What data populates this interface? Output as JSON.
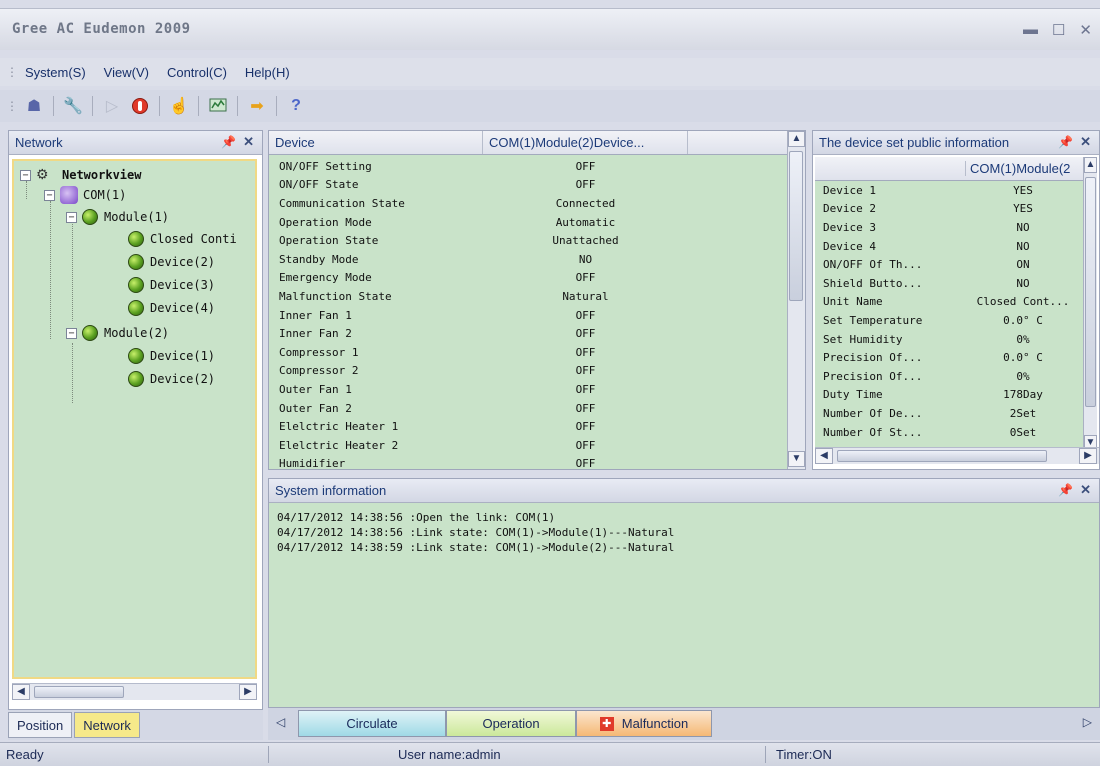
{
  "window": {
    "title": "Gree AC Eudemon 2009"
  },
  "menu": [
    "System(S)",
    "View(V)",
    "Control(C)",
    "Help(H)"
  ],
  "toolbar": [
    "network-icon",
    "wrench-icon",
    "play-icon",
    "stop-icon",
    "hand-icon",
    "monitor-icon",
    "arrow-icon",
    "help-icon"
  ],
  "network_pane": {
    "title": "Network",
    "tree": {
      "root": "Networkview",
      "com": "COM(1)",
      "module1": "Module(1)",
      "module1_children": [
        "Closed Conti",
        "Device(2)",
        "Device(3)",
        "Device(4)"
      ],
      "module2": "Module(2)",
      "module2_children": [
        "Device(1)",
        "Device(2)"
      ]
    }
  },
  "left_tabs": [
    "Position",
    "Network"
  ],
  "device_table": {
    "columns": [
      "Device",
      "COM(1)Module(2)Device..."
    ],
    "rows": [
      [
        "ON/OFF Setting",
        "OFF"
      ],
      [
        "ON/OFF State",
        "OFF"
      ],
      [
        "Communication State",
        "Connected"
      ],
      [
        "Operation Mode",
        "Automatic"
      ],
      [
        "Operation State",
        "Unattached"
      ],
      [
        "Standby Mode",
        "NO"
      ],
      [
        "Emergency Mode",
        "OFF"
      ],
      [
        "Malfunction State",
        "Natural"
      ],
      [
        "Inner Fan 1",
        "OFF"
      ],
      [
        "Inner Fan 2",
        "OFF"
      ],
      [
        "Compressor 1",
        "OFF"
      ],
      [
        "Compressor 2",
        "OFF"
      ],
      [
        "Outer Fan 1",
        "OFF"
      ],
      [
        "Outer Fan 2",
        "OFF"
      ],
      [
        "Elelctric Heater 1",
        "OFF"
      ],
      [
        "Elelctric Heater 2",
        "OFF"
      ],
      [
        "Humidifier",
        "OFF"
      ]
    ]
  },
  "info_pane": {
    "title": "The device set public information",
    "column": "COM(1)Module(2",
    "rows": [
      [
        "Device 1",
        "YES"
      ],
      [
        "Device 2",
        "YES"
      ],
      [
        "Device 3",
        "NO"
      ],
      [
        "Device 4",
        "NO"
      ],
      [
        "ON/OFF Of Th...",
        "ON"
      ],
      [
        "Shield Butto...",
        "NO"
      ],
      [
        "Unit Name",
        "Closed Cont..."
      ],
      [
        "Set Temperature",
        "0.0° C"
      ],
      [
        "Set Humidity",
        "0%"
      ],
      [
        "Precision Of...",
        "0.0° C"
      ],
      [
        "Precision Of...",
        "0%"
      ],
      [
        "Duty Time",
        "178Day"
      ],
      [
        "Number Of De...",
        "2Set"
      ],
      [
        "Number Of St...",
        "0Set"
      ]
    ]
  },
  "system_info": {
    "title": "System information",
    "lines": [
      "04/17/2012 14:38:56 :Open the link: COM(1)",
      "04/17/2012 14:38:56 :Link state: COM(1)->Module(1)---Natural",
      "04/17/2012 14:38:59 :Link state: COM(1)->Module(2)---Natural"
    ]
  },
  "bottom_tabs": [
    "Circulate",
    "Operation",
    "Malfunction"
  ],
  "status": {
    "ready": "Ready",
    "user": "User name:admin",
    "timer": "Timer:ON"
  }
}
